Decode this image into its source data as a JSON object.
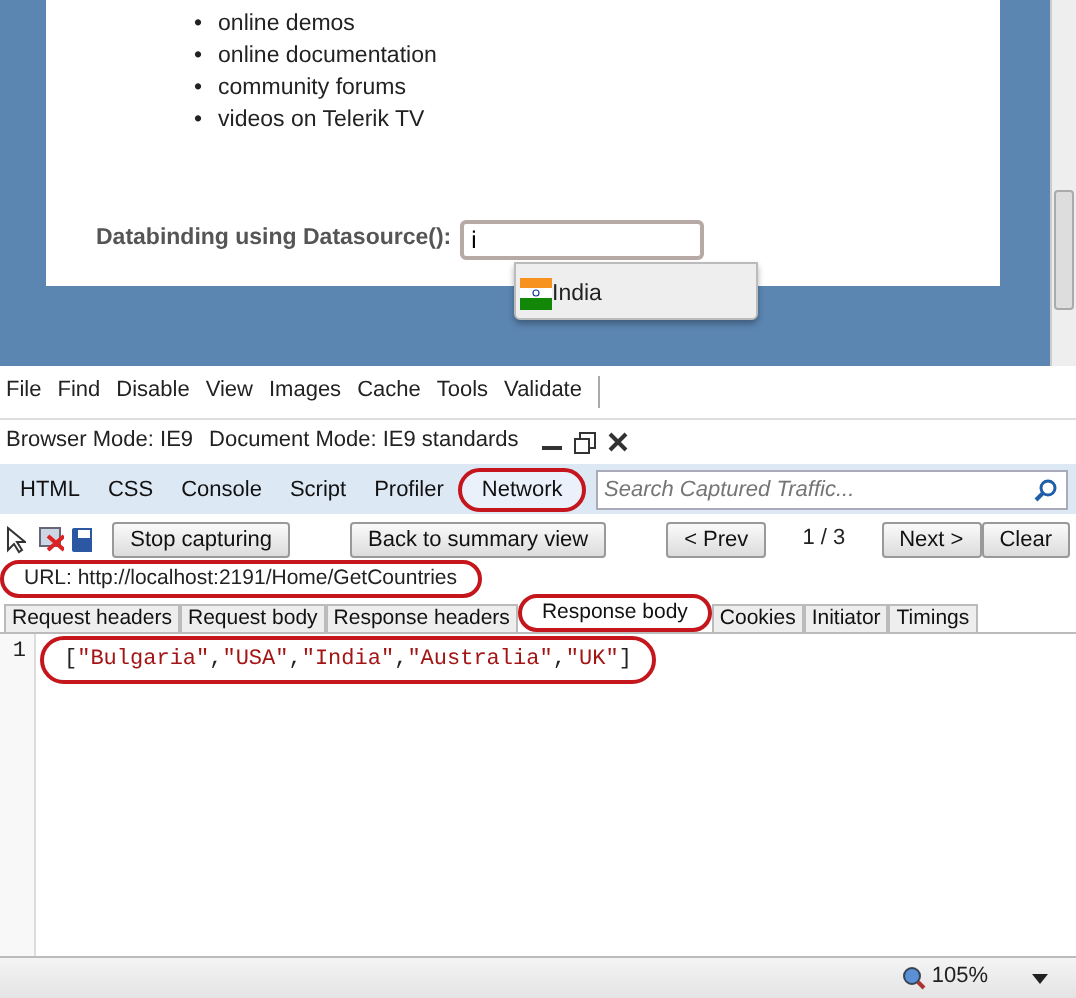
{
  "page": {
    "links": [
      {
        "bullet": "•",
        "text": "online demos"
      },
      {
        "bullet": "•",
        "text": "online documentation"
      },
      {
        "bullet": "•",
        "text": "community forums"
      },
      {
        "bullet": "•",
        "text": "videos on Telerik TV"
      }
    ],
    "combo": {
      "label": "Databinding using Datasource():",
      "value": "i",
      "suggestions": [
        {
          "text": "India"
        }
      ]
    }
  },
  "devtools": {
    "menu": [
      "File",
      "Find",
      "Disable",
      "View",
      "Images",
      "Cache",
      "Tools",
      "Validate"
    ],
    "browser_mode": "Browser Mode: IE9",
    "document_mode": "Document Mode: IE9 standards",
    "tabs": [
      {
        "label": "HTML",
        "selected": false,
        "highlighted": false
      },
      {
        "label": "CSS",
        "selected": false,
        "highlighted": false
      },
      {
        "label": "Console",
        "selected": false,
        "highlighted": false
      },
      {
        "label": "Script",
        "selected": false,
        "highlighted": false
      },
      {
        "label": "Profiler",
        "selected": false,
        "highlighted": false
      },
      {
        "label": "Network",
        "selected": true,
        "highlighted": true
      }
    ],
    "search": {
      "placeholder": "Search Captured Traffic..."
    },
    "toolbar": [
      {
        "kind": "button",
        "label": "Stop capturing"
      },
      {
        "kind": "button",
        "label": "Back to summary view"
      },
      {
        "kind": "button",
        "label": "< Prev"
      },
      {
        "kind": "text",
        "label": "1 / 3"
      },
      {
        "kind": "button",
        "label": "Next >"
      },
      {
        "kind": "button",
        "label": "Clear"
      }
    ],
    "url": {
      "text": "URL: http://localhost:2191/Home/GetCountries",
      "highlighted": true
    },
    "subtabs": [
      {
        "label": "Request headers",
        "selected": false,
        "highlighted": false
      },
      {
        "label": "Request body",
        "selected": false,
        "highlighted": false
      },
      {
        "label": "Response headers",
        "selected": false,
        "highlighted": false
      },
      {
        "label": "Response body",
        "selected": true,
        "highlighted": true
      },
      {
        "label": "Cookies",
        "selected": false,
        "highlighted": false
      },
      {
        "label": "Initiator",
        "selected": false,
        "highlighted": false
      },
      {
        "label": "Timings",
        "selected": false,
        "highlighted": false
      }
    ],
    "code": [
      {
        "line": "1",
        "text": "[\"Bulgaria\",\"USA\",\"India\",\"Australia\",\"UK\"]",
        "highlighted": true
      }
    ]
  },
  "status_bar": {
    "zoom": "105%"
  }
}
